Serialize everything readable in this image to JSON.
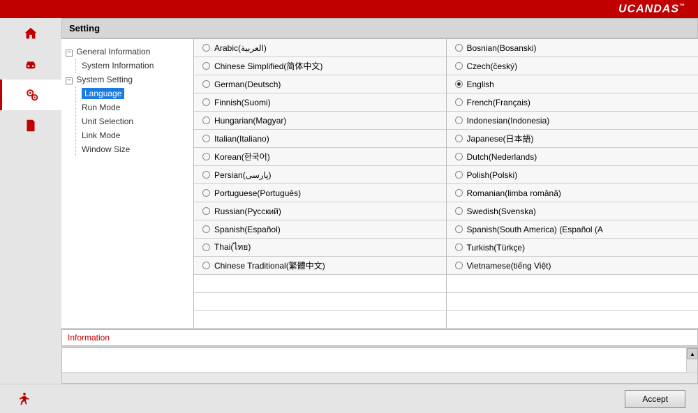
{
  "brand": "UCANDAS",
  "brand_tm": "™",
  "page_title": "Setting",
  "tree": {
    "general_info": "General Information",
    "system_info": "System Information",
    "system_setting": "System Setting",
    "language": "Language",
    "run_mode": "Run Mode",
    "unit_selection": "Unit Selection",
    "link_mode": "Link Mode",
    "window_size": "Window Size"
  },
  "languages_col1": [
    {
      "label": "Arabic(العربية)",
      "selected": false
    },
    {
      "label": "Chinese Simplified(简体中文)",
      "selected": false
    },
    {
      "label": "German(Deutsch)",
      "selected": false
    },
    {
      "label": "Finnish(Suomi)",
      "selected": false
    },
    {
      "label": "Hungarian(Magyar)",
      "selected": false
    },
    {
      "label": "Italian(Italiano)",
      "selected": false
    },
    {
      "label": "Korean(한국어)",
      "selected": false
    },
    {
      "label": "Persian(پارسی)",
      "selected": false
    },
    {
      "label": "Portuguese(Português)",
      "selected": false
    },
    {
      "label": "Russian(Русский)",
      "selected": false
    },
    {
      "label": "Spanish(Español)",
      "selected": false
    },
    {
      "label": "Thai(ไทย)",
      "selected": false
    },
    {
      "label": "Chinese Traditional(繁體中文)",
      "selected": false
    }
  ],
  "languages_col2": [
    {
      "label": "Bosnian(Bosanski)",
      "selected": false
    },
    {
      "label": "Czech(český)",
      "selected": false
    },
    {
      "label": "English",
      "selected": true
    },
    {
      "label": "French(Français)",
      "selected": false
    },
    {
      "label": "Indonesian(Indonesia)",
      "selected": false
    },
    {
      "label": "Japanese(日本語)",
      "selected": false
    },
    {
      "label": "Dutch(Nederlands)",
      "selected": false
    },
    {
      "label": "Polish(Polski)",
      "selected": false
    },
    {
      "label": "Romanian(limba română)",
      "selected": false
    },
    {
      "label": "Swedish(Svenska)",
      "selected": false
    },
    {
      "label": "Spanish(South America) (Español (A",
      "selected": false
    },
    {
      "label": "Turkish(Türkçe)",
      "selected": false
    },
    {
      "label": "Vietnamese(tiếng Việt)",
      "selected": false
    }
  ],
  "info_label": "Information",
  "accept_label": "Accept"
}
